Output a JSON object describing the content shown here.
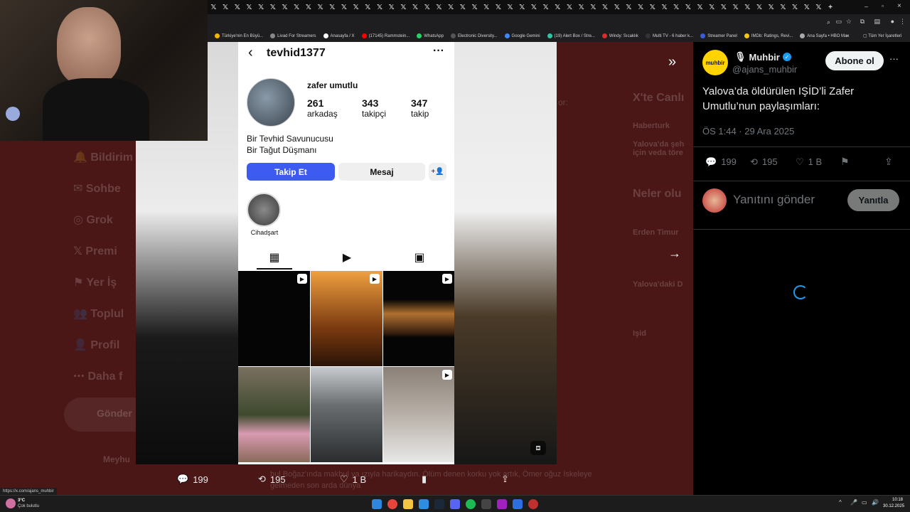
{
  "browser": {
    "tabs_count": 52,
    "new_tab": "+",
    "window_controls": [
      "–",
      "▫",
      "×"
    ],
    "bookmarks": [
      {
        "label": "Türkiye'nin En Büyü...",
        "color": "#f4b400"
      },
      {
        "label": "Livad For Streamers",
        "color": "#888888"
      },
      {
        "label": "Anasayfa / X",
        "color": "#ffffff"
      },
      {
        "label": "(17145) Rammstein...",
        "color": "#ff0000"
      },
      {
        "label": "WhatsApp",
        "color": "#25d366"
      },
      {
        "label": "Electronic Diversity...",
        "color": "#555555"
      },
      {
        "label": "Google Gemini",
        "color": "#4285f4"
      },
      {
        "label": "(19) Alert Box / Stre...",
        "color": "#31c3a2"
      },
      {
        "label": "Windy: Sıcaklık",
        "color": "#d92c2c"
      },
      {
        "label": "Multi TV - 6 haber k...",
        "color": "#333333"
      },
      {
        "label": "Streamer Panel",
        "color": "#3b5bdb"
      },
      {
        "label": "IMDb: Ratings, Revi...",
        "color": "#f5c518"
      },
      {
        "label": "Ana Sayfa • HBO Max",
        "color": "#aaaaaa"
      }
    ],
    "bookmarks_more": "»",
    "all_bookmarks": "Tüm Yer İşaretleri"
  },
  "background_nav": {
    "items": [
      "Bildirim",
      "Sohbe",
      "Grok",
      "Premi",
      "Yer İş",
      "Toplul",
      "Profil",
      "Daha f"
    ],
    "post_button": "Gönder",
    "trends_title": "X'te Canlı",
    "trends_header": "Neler olu",
    "trend_items": [
      "Haberturk",
      "Yalova'da şeh için veda töre",
      "Erden Timur",
      "Yalova'daki D",
      "Işid"
    ],
    "footer_user": "Meyhu",
    "footer_text": "bul Boğaz'ında makbul ya ızıyla harikaydın. Ölüm denen korku yok artık, Ömer oğuz İskeleye gelmeden son arda dünya",
    "reply_label_ghost": "or:"
  },
  "instagram": {
    "username": "tevhid1377",
    "display_name": "zafer umutlu",
    "stats": [
      {
        "number": "261",
        "label": "arkadaş"
      },
      {
        "number": "343",
        "label": "takipçi"
      },
      {
        "number": "347",
        "label": "takip"
      }
    ],
    "bio_lines": [
      "Bir Tevhid Savunucusu",
      "Bir Tağut Düşmanı"
    ],
    "follow_button": "Takip Et",
    "message_button": "Mesaj",
    "highlight_label": "Cihadşart"
  },
  "media_actions": {
    "replies": "199",
    "reposts": "195",
    "likes": "1 B"
  },
  "tweet": {
    "author_name": "Muhbir",
    "author_handle": "@ajans_muhbir",
    "avatar_text": "muhbir",
    "follow_button": "Abone ol",
    "text": "Yalova’da öldürülen IŞİD’li Zafer Umutlu’nun paylaşımları:",
    "timestamp": "ÖS 1:44 · 29 Ara 2025",
    "replies": "199",
    "reposts": "195",
    "likes": "1 B",
    "reply_placeholder": "Yanıtını gönder",
    "reply_button": "Yanıtla",
    "accent": "#1d9bf0"
  },
  "status_url": "https://x.com/ajans_muhbir",
  "taskbar": {
    "weather_temp": "3°C",
    "weather_desc": "Çok bulutlu",
    "time": "10:18",
    "date": "30.12.2025"
  }
}
